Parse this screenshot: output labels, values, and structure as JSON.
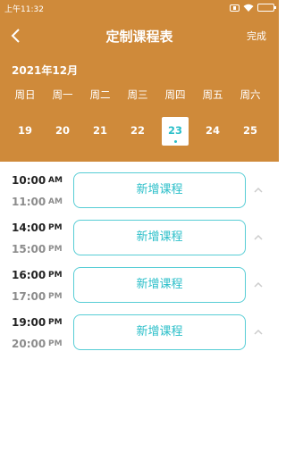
{
  "status_bar": {
    "time": "上午11:32"
  },
  "header": {
    "title": "定制课程表",
    "done_label": "完成",
    "month": "2021年12月",
    "accent_color": "#cf8a3a",
    "selected_color": "#2bbfc9"
  },
  "weekdays": [
    "周日",
    "周一",
    "周二",
    "周三",
    "周四",
    "周五",
    "周六"
  ],
  "dates": [
    {
      "day": "19",
      "selected": false
    },
    {
      "day": "20",
      "selected": false
    },
    {
      "day": "21",
      "selected": false
    },
    {
      "day": "22",
      "selected": false
    },
    {
      "day": "23",
      "selected": true
    },
    {
      "day": "24",
      "selected": false
    },
    {
      "day": "25",
      "selected": false
    }
  ],
  "courses": [
    {
      "start": "10:00",
      "start_period": "AM",
      "end": "11:00",
      "end_period": "AM",
      "button_label": "新增课程"
    },
    {
      "start": "14:00",
      "start_period": "PM",
      "end": "15:00",
      "end_period": "PM",
      "button_label": "新增课程"
    },
    {
      "start": "16:00",
      "start_period": "PM",
      "end": "17:00",
      "end_period": "PM",
      "button_label": "新增课程"
    },
    {
      "start": "19:00",
      "start_period": "PM",
      "end": "20:00",
      "end_period": "PM",
      "button_label": "新增课程"
    }
  ]
}
